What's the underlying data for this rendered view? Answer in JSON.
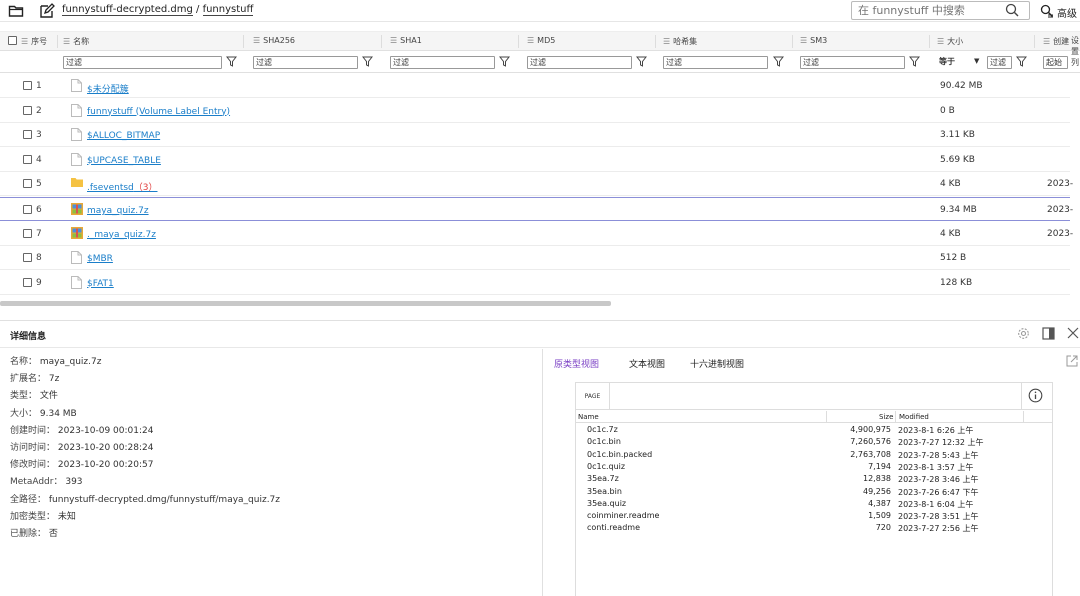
{
  "toolbar": {
    "path_parts": [
      "funnystuff-decrypted.dmg",
      "funnystuff"
    ],
    "path_sep": " / ",
    "search_placeholder": "在 funnystuff 中搜索",
    "advanced_label": "高级"
  },
  "columns": [
    {
      "label": "序号"
    },
    {
      "label": "名称"
    },
    {
      "label": "SHA256"
    },
    {
      "label": "SHA1"
    },
    {
      "label": "MD5"
    },
    {
      "label": "哈希集"
    },
    {
      "label": "SM3"
    },
    {
      "label": "大小"
    },
    {
      "label": "创建"
    }
  ],
  "filters": {
    "placeholder": "过滤",
    "size_op": "等于",
    "date_op": "起始"
  },
  "rows": [
    {
      "no": "1",
      "name": "$未分配簇",
      "count": "",
      "size": "90.42 MB",
      "created": "",
      "icon": "file-icon"
    },
    {
      "no": "2",
      "name": "funnystuff (Volume Label Entry)",
      "count": "",
      "size": "0 B",
      "created": "",
      "icon": "file-icon"
    },
    {
      "no": "3",
      "name": "$ALLOC_BITMAP",
      "count": "",
      "size": "3.11 KB",
      "created": "",
      "icon": "file-icon"
    },
    {
      "no": "4",
      "name": "$UPCASE_TABLE",
      "count": "",
      "size": "5.69 KB",
      "created": "",
      "icon": "file-icon"
    },
    {
      "no": "5",
      "name": ".fseventsd",
      "count": "（3）",
      "size": "4 KB",
      "created": "2023-",
      "icon": "folder-icon"
    },
    {
      "no": "6",
      "name": "maya_quiz.7z",
      "count": "",
      "size": "9.34 MB",
      "created": "2023-",
      "icon": "archive-icon"
    },
    {
      "no": "7",
      "name": "._maya_quiz.7z",
      "count": "",
      "size": "4 KB",
      "created": "2023-",
      "icon": "archive-icon"
    },
    {
      "no": "8",
      "name": "$MBR",
      "count": "",
      "size": "512 B",
      "created": "",
      "icon": "file-icon"
    },
    {
      "no": "9",
      "name": "$FAT1",
      "count": "",
      "size": "128 KB",
      "created": "",
      "icon": "file-icon"
    }
  ],
  "right_edge_text": "设置列",
  "detail": {
    "title": "详细信息",
    "props": [
      {
        "k": "名称：",
        "v": "maya_quiz.7z"
      },
      {
        "k": "扩展名：",
        "v": "7z"
      },
      {
        "k": "类型：",
        "v": "文件"
      },
      {
        "k": "大小：",
        "v": "9.34 MB"
      },
      {
        "k": "创建时间：",
        "v": "2023-10-09 00:01:24"
      },
      {
        "k": "访问时间：",
        "v": "2023-10-20 00:28:24"
      },
      {
        "k": "修改时间：",
        "v": "2023-10-20 00:20:57"
      },
      {
        "k": "MetaAddr：",
        "v": "393"
      },
      {
        "k": "全路径：",
        "v": "funnystuff-decrypted.dmg/funnystuff/maya_quiz.7z"
      },
      {
        "k": "加密类型：",
        "v": "未知"
      },
      {
        "k": "已删除：",
        "v": "否"
      }
    ],
    "tabs": [
      "原类型视图",
      "文本视图",
      "十六进制视图"
    ]
  },
  "preview": {
    "page_label": "PAGE",
    "headers": {
      "name": "Name",
      "size": "Size",
      "modified": "Modified"
    },
    "files": [
      {
        "name": "0c1c.7z",
        "size": "4,900,975",
        "modified": "2023-8-1 6:26 上午"
      },
      {
        "name": "0c1c.bin",
        "size": "7,260,576",
        "modified": "2023-7-27 12:32 上午"
      },
      {
        "name": "0c1c.bin.packed",
        "size": "2,763,708",
        "modified": "2023-7-28 5:43 上午"
      },
      {
        "name": "0c1c.quiz",
        "size": "7,194",
        "modified": "2023-8-1 3:57 上午"
      },
      {
        "name": "35ea.7z",
        "size": "12,838",
        "modified": "2023-7-28 3:46 上午"
      },
      {
        "name": "35ea.bin",
        "size": "49,256",
        "modified": "2023-7-26 6:47 下午"
      },
      {
        "name": "35ea.quiz",
        "size": "4,387",
        "modified": "2023-8-1 6:04 上午"
      },
      {
        "name": "coinminer.readme",
        "size": "1,509",
        "modified": "2023-7-28 3:51 上午"
      },
      {
        "name": "conti.readme",
        "size": "720",
        "modified": "2023-7-27 2:56 上午"
      }
    ]
  }
}
